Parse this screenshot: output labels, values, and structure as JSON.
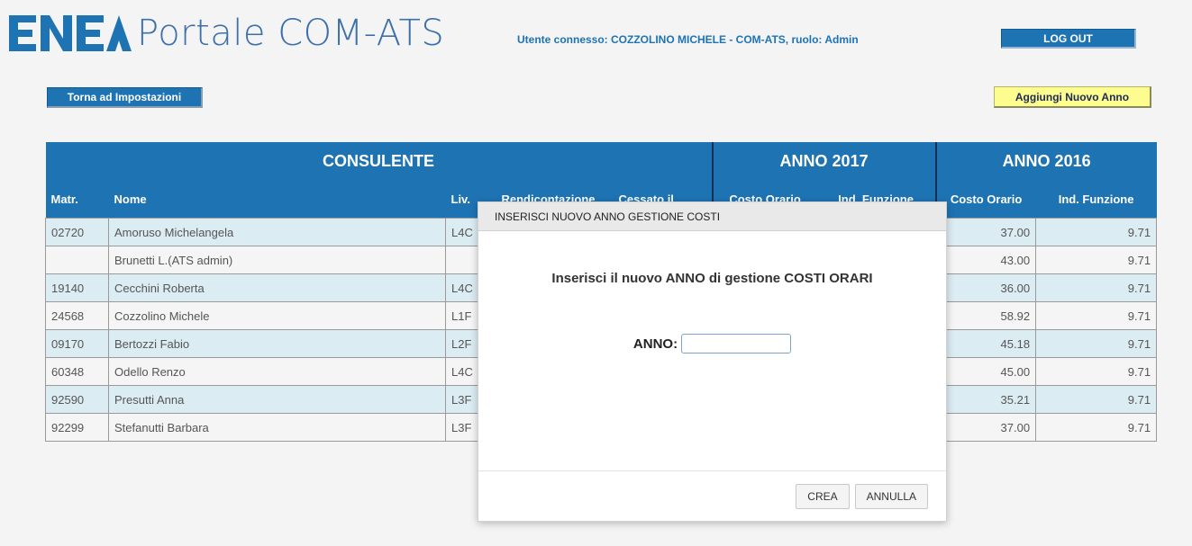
{
  "header": {
    "app_title": "Portale COM-ATS",
    "logo_text": "ENEA",
    "user_info": "Utente connesso: COZZOLINO MICHELE - COM-ATS, ruolo: Admin",
    "logout_label": "LOG OUT"
  },
  "toolbar": {
    "back_label": "Torna ad Impostazioni",
    "add_year_label": "Aggiungi Nuovo Anno"
  },
  "table": {
    "groups": [
      "CONSULENTE",
      "ANNO 2017",
      "ANNO 2016"
    ],
    "columns": [
      "Matr.",
      "Nome",
      "Liv.",
      "Rendicontazione",
      "Cessato il",
      "Costo Orario",
      "Ind. Funzione",
      "Costo Orario",
      "Ind. Funzione"
    ],
    "rows": [
      {
        "matr": "02720",
        "nome": "Amoruso Michelangela",
        "liv": "L4C",
        "costo2016": "37.00",
        "ind2016": "9.71"
      },
      {
        "matr": "",
        "nome": "Brunetti L.(ATS admin)",
        "liv": "",
        "costo2016": "43.00",
        "ind2016": "9.71"
      },
      {
        "matr": "19140",
        "nome": "Cecchini Roberta",
        "liv": "L4C",
        "costo2016": "36.00",
        "ind2016": "9.71"
      },
      {
        "matr": "24568",
        "nome": "Cozzolino Michele",
        "liv": "L1F",
        "costo2016": "58.92",
        "ind2016": "9.71"
      },
      {
        "matr": "09170",
        "nome": "Bertozzi Fabio",
        "liv": "L2F",
        "costo2016": "45.18",
        "ind2016": "9.71"
      },
      {
        "matr": "60348",
        "nome": "Odello Renzo",
        "liv": "L4C",
        "costo2016": "45.00",
        "ind2016": "9.71"
      },
      {
        "matr": "92590",
        "nome": "Presutti Anna",
        "liv": "L3F",
        "costo2016": "35.21",
        "ind2016": "9.71"
      },
      {
        "matr": "92299",
        "nome": "Stefanutti Barbara",
        "liv": "L3F",
        "costo2016": "37.00",
        "ind2016": "9.71"
      }
    ]
  },
  "dialog": {
    "title": "INSERISCI NUOVO ANNO GESTIONE COSTI",
    "message": "Inserisci il nuovo ANNO di gestione COSTI ORARI",
    "field_label": "ANNO:",
    "field_value": "",
    "create_label": "CREA",
    "cancel_label": "ANNULLA"
  },
  "colors": {
    "primary": "#1e73b3",
    "row_highlight": "#dcecf3",
    "add_button": "#fdfd8f"
  }
}
